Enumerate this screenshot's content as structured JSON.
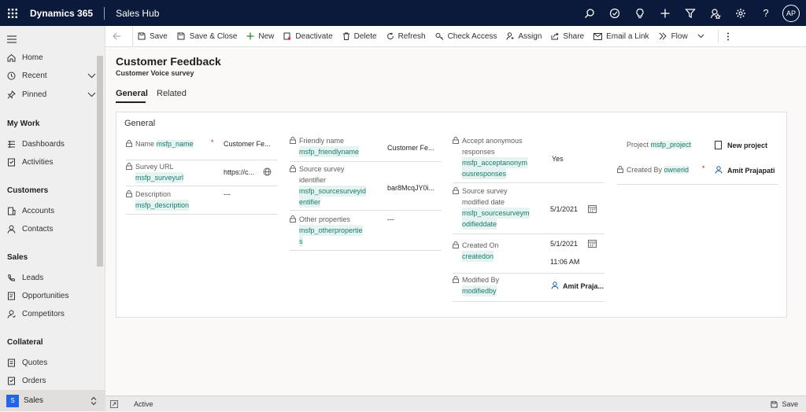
{
  "header": {
    "brand": "Dynamics 365",
    "app": "Sales Hub",
    "avatar": "AP"
  },
  "sidebar": {
    "top": [
      {
        "label": "Home"
      },
      {
        "label": "Recent"
      },
      {
        "label": "Pinned"
      }
    ],
    "groups": [
      {
        "title": "My Work",
        "items": [
          "Dashboards",
          "Activities"
        ]
      },
      {
        "title": "Customers",
        "items": [
          "Accounts",
          "Contacts"
        ]
      },
      {
        "title": "Sales",
        "items": [
          "Leads",
          "Opportunities",
          "Competitors"
        ]
      },
      {
        "title": "Collateral",
        "items": [
          "Quotes",
          "Orders"
        ]
      }
    ],
    "area": {
      "badge": "S",
      "label": "Sales"
    }
  },
  "commands": [
    "Save",
    "Save & Close",
    "New",
    "Deactivate",
    "Delete",
    "Refresh",
    "Check Access",
    "Assign",
    "Share",
    "Email a Link",
    "Flow"
  ],
  "record": {
    "title": "Customer Feedback",
    "subtitle": "Customer Voice survey"
  },
  "tabs": [
    "General",
    "Related"
  ],
  "section": {
    "title": "General"
  },
  "fields": {
    "name": {
      "label": "Name",
      "schema": "msfp_name",
      "value": "Customer Fe..."
    },
    "surveyurl": {
      "label": "Survey URL",
      "schema": "msfp_surveyurl",
      "value": "https://c..."
    },
    "description": {
      "label": "Description",
      "schema": "msfp_description",
      "value": "---"
    },
    "friendlyname": {
      "label": "Friendly name",
      "schema": "msfp_friendlyname",
      "value": "Customer Fe..."
    },
    "sourcesurvey": {
      "label1": "Source survey",
      "label2": "identifier",
      "schema1": "msfp_sourcesurveyid",
      "schema2": "entifier",
      "value": "bar8McqJY0i..."
    },
    "otherprops": {
      "label": "Other properties",
      "schema1": "msfp_otherpropertie",
      "schema2": "s",
      "value": "---"
    },
    "anon": {
      "label1": "Accept anonymous",
      "label2": "responses",
      "schema1": "msfp_acceptanonym",
      "schema2": "ousresponses",
      "value": "Yes"
    },
    "srcmodified": {
      "label1": "Source survey",
      "label2": "modified date",
      "schema1": "msfp_sourcesurveym",
      "schema2": "odifieddate",
      "value": "5/1/2021"
    },
    "createdon": {
      "label": "Created On",
      "schema": "createdon",
      "date": "5/1/2021",
      "time": "11:06 AM"
    },
    "modifiedby": {
      "label": "Modified By",
      "schema": "modifiedby",
      "value": "Amit Praja..."
    },
    "project": {
      "label": "Project",
      "schema": "msfp_project",
      "value": "New project"
    },
    "createdby": {
      "label": "Created By",
      "schema": "ownerid",
      "value": "Amit Prajapati"
    }
  },
  "footer": {
    "status": "Active",
    "save": "Save"
  }
}
